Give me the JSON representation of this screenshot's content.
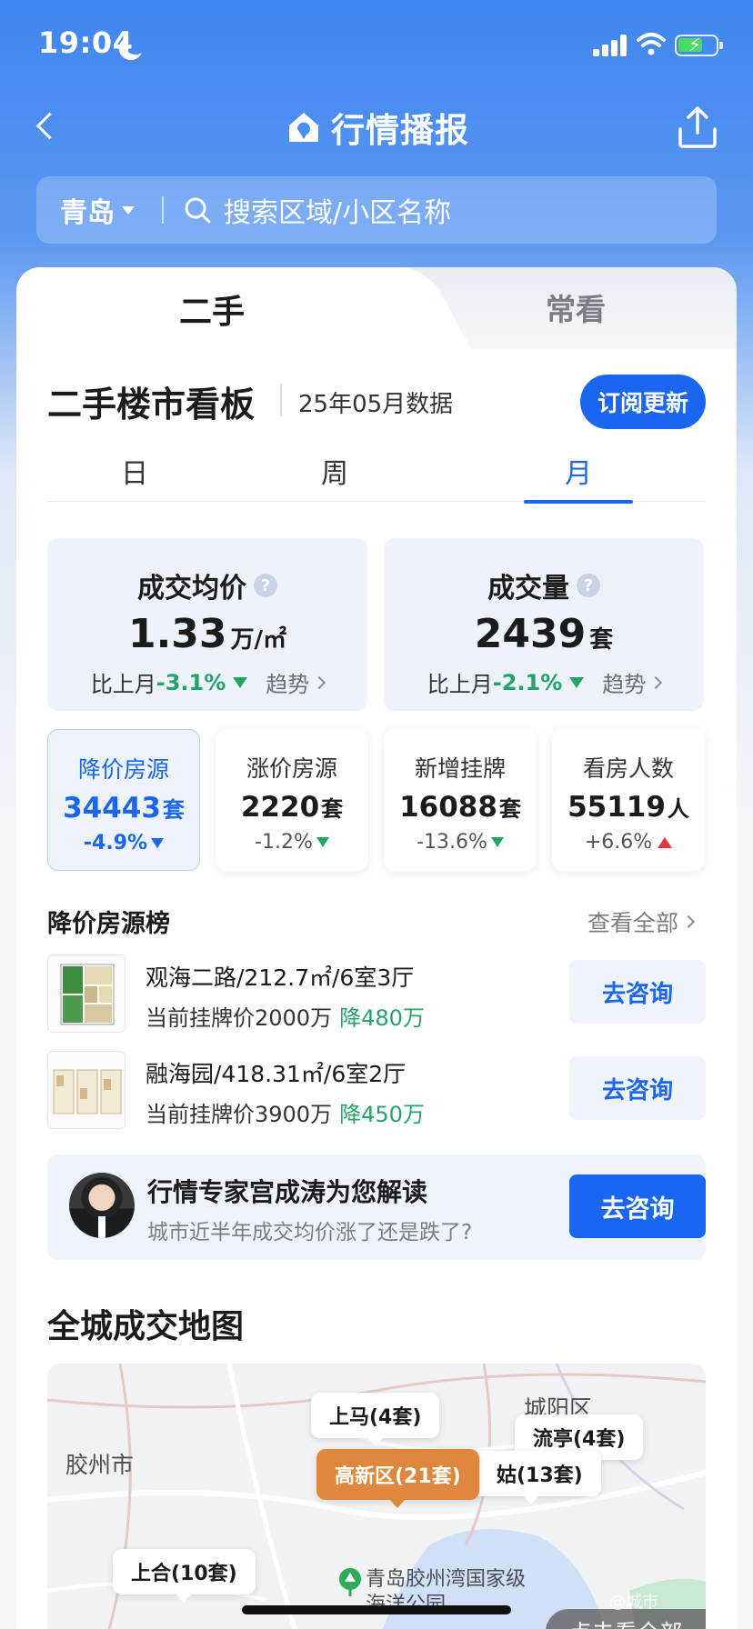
{
  "status_bar": {
    "time": "19:04"
  },
  "nav": {
    "title": "行情播报"
  },
  "search": {
    "city": "青岛",
    "placeholder": "搜索区域/小区名称"
  },
  "tabs": [
    {
      "label": "二手"
    },
    {
      "label": "常看"
    }
  ],
  "board": {
    "title": "二手楼市看板",
    "date": "25年05月数据",
    "subscribe_label": "订阅更新",
    "periods": [
      {
        "label": "日"
      },
      {
        "label": "周"
      },
      {
        "label": "月",
        "active": true
      }
    ]
  },
  "stats": [
    {
      "label": "成交均价",
      "value": "1.33",
      "unit": "万/㎡",
      "compare_label": "比上月",
      "change": "-3.1%",
      "trend_label": "趋势"
    },
    {
      "label": "成交量",
      "value": "2439",
      "unit": "套",
      "compare_label": "比上月",
      "change": "-2.1%",
      "trend_label": "趋势"
    }
  ],
  "metrics": [
    {
      "label": "降价房源",
      "value": "34443",
      "unit": "套",
      "change": "-4.9%",
      "direction": "down",
      "active": true
    },
    {
      "label": "涨价房源",
      "value": "2220",
      "unit": "套",
      "change": "-1.2%",
      "direction": "down"
    },
    {
      "label": "新增挂牌",
      "value": "16088",
      "unit": "套",
      "change": "-13.6%",
      "direction": "down"
    },
    {
      "label": "看房人数",
      "value": "55119",
      "unit": "人",
      "change": "+6.6%",
      "direction": "up"
    }
  ],
  "price_drop_list": {
    "title": "降价房源榜",
    "view_all": "查看全部",
    "items": [
      {
        "title": "观海二路/212.7㎡/6室3厅",
        "price_label": "当前挂牌价2000万",
        "drop": "降480万",
        "button": "去咨询"
      },
      {
        "title": "融海园/418.31㎡/6室2厅",
        "price_label": "当前挂牌价3900万",
        "drop": "降450万",
        "button": "去咨询"
      }
    ]
  },
  "expert": {
    "title": "行情专家宫成涛为您解读",
    "subtitle": "城市近半年成交均价涨了还是跌了?",
    "button": "去咨询"
  },
  "map": {
    "title": "全城成交地图",
    "labels": {
      "jiaozhou": "胶州市",
      "chengyang": "城阳区"
    },
    "pins": {
      "shangma": "上马(4套)",
      "liuting": "流亭(4套)",
      "gaoxin": "高新区(21套)",
      "hongdaogu": "姑(13套)",
      "shanghe": "上合(10套)"
    },
    "park": "青岛胶州湾国家级海洋公园",
    "overlay_button": "点击看全部"
  },
  "watermark": "@城市"
}
